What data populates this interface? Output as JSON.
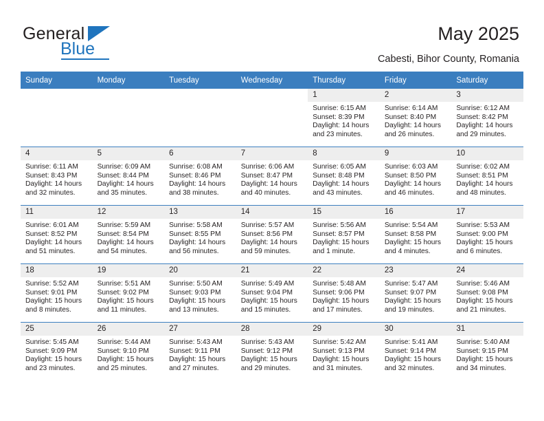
{
  "brand": {
    "name_top": "General",
    "name_bottom": "Blue",
    "accent_color": "#1f74bd"
  },
  "header": {
    "title": "May 2025",
    "subtitle": "Cabesti, Bihor County, Romania"
  },
  "theme": {
    "header_row_bg": "#3b7ebf",
    "header_row_text": "#ffffff",
    "daynum_bg": "#eeeeee",
    "text": "#231f20"
  },
  "weekday_headers": [
    "Sunday",
    "Monday",
    "Tuesday",
    "Wednesday",
    "Thursday",
    "Friday",
    "Saturday"
  ],
  "weeks": [
    [
      {
        "day": "",
        "empty": true
      },
      {
        "day": "",
        "empty": true
      },
      {
        "day": "",
        "empty": true
      },
      {
        "day": "",
        "empty": true
      },
      {
        "day": "1",
        "sunrise": "Sunrise: 6:15 AM",
        "sunset": "Sunset: 8:39 PM",
        "daylight": "Daylight: 14 hours and 23 minutes."
      },
      {
        "day": "2",
        "sunrise": "Sunrise: 6:14 AM",
        "sunset": "Sunset: 8:40 PM",
        "daylight": "Daylight: 14 hours and 26 minutes."
      },
      {
        "day": "3",
        "sunrise": "Sunrise: 6:12 AM",
        "sunset": "Sunset: 8:42 PM",
        "daylight": "Daylight: 14 hours and 29 minutes."
      }
    ],
    [
      {
        "day": "4",
        "sunrise": "Sunrise: 6:11 AM",
        "sunset": "Sunset: 8:43 PM",
        "daylight": "Daylight: 14 hours and 32 minutes."
      },
      {
        "day": "5",
        "sunrise": "Sunrise: 6:09 AM",
        "sunset": "Sunset: 8:44 PM",
        "daylight": "Daylight: 14 hours and 35 minutes."
      },
      {
        "day": "6",
        "sunrise": "Sunrise: 6:08 AM",
        "sunset": "Sunset: 8:46 PM",
        "daylight": "Daylight: 14 hours and 38 minutes."
      },
      {
        "day": "7",
        "sunrise": "Sunrise: 6:06 AM",
        "sunset": "Sunset: 8:47 PM",
        "daylight": "Daylight: 14 hours and 40 minutes."
      },
      {
        "day": "8",
        "sunrise": "Sunrise: 6:05 AM",
        "sunset": "Sunset: 8:48 PM",
        "daylight": "Daylight: 14 hours and 43 minutes."
      },
      {
        "day": "9",
        "sunrise": "Sunrise: 6:03 AM",
        "sunset": "Sunset: 8:50 PM",
        "daylight": "Daylight: 14 hours and 46 minutes."
      },
      {
        "day": "10",
        "sunrise": "Sunrise: 6:02 AM",
        "sunset": "Sunset: 8:51 PM",
        "daylight": "Daylight: 14 hours and 48 minutes."
      }
    ],
    [
      {
        "day": "11",
        "sunrise": "Sunrise: 6:01 AM",
        "sunset": "Sunset: 8:52 PM",
        "daylight": "Daylight: 14 hours and 51 minutes."
      },
      {
        "day": "12",
        "sunrise": "Sunrise: 5:59 AM",
        "sunset": "Sunset: 8:54 PM",
        "daylight": "Daylight: 14 hours and 54 minutes."
      },
      {
        "day": "13",
        "sunrise": "Sunrise: 5:58 AM",
        "sunset": "Sunset: 8:55 PM",
        "daylight": "Daylight: 14 hours and 56 minutes."
      },
      {
        "day": "14",
        "sunrise": "Sunrise: 5:57 AM",
        "sunset": "Sunset: 8:56 PM",
        "daylight": "Daylight: 14 hours and 59 minutes."
      },
      {
        "day": "15",
        "sunrise": "Sunrise: 5:56 AM",
        "sunset": "Sunset: 8:57 PM",
        "daylight": "Daylight: 15 hours and 1 minute."
      },
      {
        "day": "16",
        "sunrise": "Sunrise: 5:54 AM",
        "sunset": "Sunset: 8:58 PM",
        "daylight": "Daylight: 15 hours and 4 minutes."
      },
      {
        "day": "17",
        "sunrise": "Sunrise: 5:53 AM",
        "sunset": "Sunset: 9:00 PM",
        "daylight": "Daylight: 15 hours and 6 minutes."
      }
    ],
    [
      {
        "day": "18",
        "sunrise": "Sunrise: 5:52 AM",
        "sunset": "Sunset: 9:01 PM",
        "daylight": "Daylight: 15 hours and 8 minutes."
      },
      {
        "day": "19",
        "sunrise": "Sunrise: 5:51 AM",
        "sunset": "Sunset: 9:02 PM",
        "daylight": "Daylight: 15 hours and 11 minutes."
      },
      {
        "day": "20",
        "sunrise": "Sunrise: 5:50 AM",
        "sunset": "Sunset: 9:03 PM",
        "daylight": "Daylight: 15 hours and 13 minutes."
      },
      {
        "day": "21",
        "sunrise": "Sunrise: 5:49 AM",
        "sunset": "Sunset: 9:04 PM",
        "daylight": "Daylight: 15 hours and 15 minutes."
      },
      {
        "day": "22",
        "sunrise": "Sunrise: 5:48 AM",
        "sunset": "Sunset: 9:06 PM",
        "daylight": "Daylight: 15 hours and 17 minutes."
      },
      {
        "day": "23",
        "sunrise": "Sunrise: 5:47 AM",
        "sunset": "Sunset: 9:07 PM",
        "daylight": "Daylight: 15 hours and 19 minutes."
      },
      {
        "day": "24",
        "sunrise": "Sunrise: 5:46 AM",
        "sunset": "Sunset: 9:08 PM",
        "daylight": "Daylight: 15 hours and 21 minutes."
      }
    ],
    [
      {
        "day": "25",
        "sunrise": "Sunrise: 5:45 AM",
        "sunset": "Sunset: 9:09 PM",
        "daylight": "Daylight: 15 hours and 23 minutes."
      },
      {
        "day": "26",
        "sunrise": "Sunrise: 5:44 AM",
        "sunset": "Sunset: 9:10 PM",
        "daylight": "Daylight: 15 hours and 25 minutes."
      },
      {
        "day": "27",
        "sunrise": "Sunrise: 5:43 AM",
        "sunset": "Sunset: 9:11 PM",
        "daylight": "Daylight: 15 hours and 27 minutes."
      },
      {
        "day": "28",
        "sunrise": "Sunrise: 5:43 AM",
        "sunset": "Sunset: 9:12 PM",
        "daylight": "Daylight: 15 hours and 29 minutes."
      },
      {
        "day": "29",
        "sunrise": "Sunrise: 5:42 AM",
        "sunset": "Sunset: 9:13 PM",
        "daylight": "Daylight: 15 hours and 31 minutes."
      },
      {
        "day": "30",
        "sunrise": "Sunrise: 5:41 AM",
        "sunset": "Sunset: 9:14 PM",
        "daylight": "Daylight: 15 hours and 32 minutes."
      },
      {
        "day": "31",
        "sunrise": "Sunrise: 5:40 AM",
        "sunset": "Sunset: 9:15 PM",
        "daylight": "Daylight: 15 hours and 34 minutes."
      }
    ]
  ]
}
